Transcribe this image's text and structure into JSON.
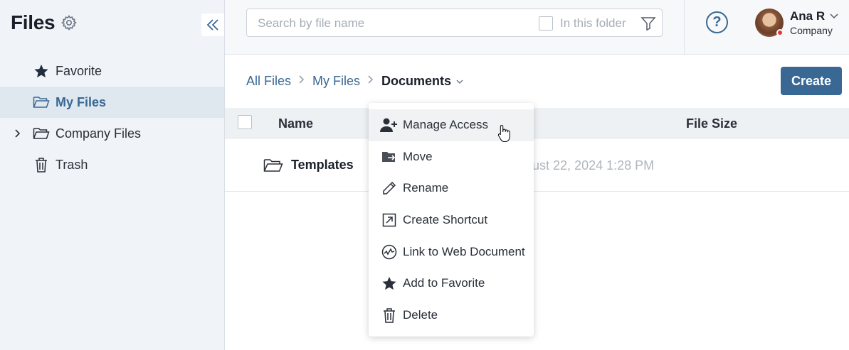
{
  "sidebar": {
    "title": "Files",
    "items": [
      {
        "label": "Favorite",
        "icon": "star-icon"
      },
      {
        "label": "My Files",
        "icon": "folder-open-icon",
        "active": true
      },
      {
        "label": "Company Files",
        "icon": "folder-open-icon",
        "expandable": true
      },
      {
        "label": "Trash",
        "icon": "trash-icon"
      }
    ]
  },
  "topbar": {
    "search_placeholder": "Search by file name",
    "in_folder_label": "In this folder",
    "help_label": "?",
    "user": {
      "name": "Ana R",
      "company": "Company",
      "status_color": "#e53935"
    }
  },
  "breadcrumb": {
    "items": [
      "All Files",
      "My Files"
    ],
    "current": "Documents"
  },
  "create_label": "Create",
  "table": {
    "columns": {
      "name": "Name",
      "size": "File Size"
    },
    "rows": [
      {
        "name": "Templates",
        "date": "August 22, 2024 1:28 PM",
        "icon": "folder-open-icon"
      }
    ]
  },
  "context_menu": {
    "items": [
      {
        "label": "Manage Access",
        "icon": "user-add-icon",
        "hovered": true
      },
      {
        "label": "Move",
        "icon": "move-folder-icon"
      },
      {
        "label": "Rename",
        "icon": "pencil-icon"
      },
      {
        "label": "Create Shortcut",
        "icon": "shortcut-icon"
      },
      {
        "label": "Link to Web Document",
        "icon": "web-link-icon"
      },
      {
        "label": "Add to Favorite",
        "icon": "star-icon"
      },
      {
        "label": "Delete",
        "icon": "trash-icon"
      }
    ]
  },
  "colors": {
    "accent": "#3a6894",
    "sidebar_bg": "#f0f4f8",
    "active_bg": "#dfe7ef"
  }
}
